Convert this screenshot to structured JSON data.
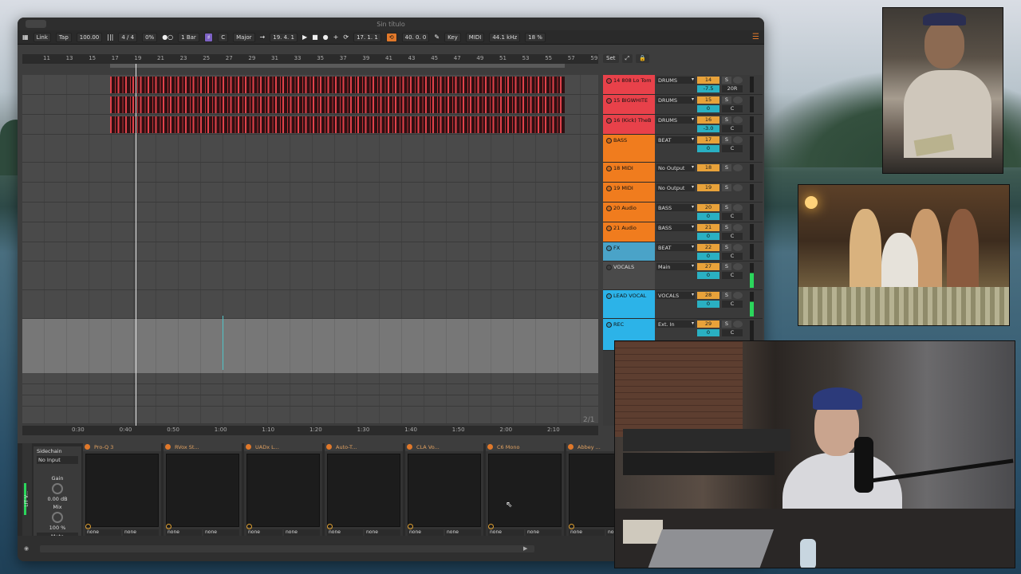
{
  "window": {
    "title": "Sin título"
  },
  "control_bar": {
    "link": "Link",
    "tap": "Tap",
    "tempo": "100.00",
    "signature": "4 / 4",
    "swing": "0%",
    "quantize": "1 Bar",
    "key": "C",
    "scale": "Major",
    "position": "19. 4. 1",
    "loop_start": "17. 1. 1",
    "loop_length": "40. 0. 0",
    "key_map": "Key",
    "midi_map": "MIDI",
    "sample_rate": "44.1 kHz",
    "cpu": "18 %"
  },
  "beat_ruler": [
    "11",
    "13",
    "15",
    "17",
    "19",
    "21",
    "23",
    "25",
    "27",
    "29",
    "31",
    "33",
    "35",
    "37",
    "39",
    "41",
    "43",
    "45",
    "47",
    "49",
    "51",
    "53",
    "55",
    "57",
    "59"
  ],
  "time_ruler": [
    "0:30",
    "0:40",
    "0:50",
    "1:00",
    "1:10",
    "1:20",
    "1:30",
    "1:40",
    "1:50",
    "2:00",
    "2:10"
  ],
  "set_buttons": {
    "set": "Set"
  },
  "page_indicator": "2/1",
  "tracks": [
    {
      "name": "14 808 Lo Tom",
      "route": "DRUMS",
      "num": "14",
      "vol": "-7.5",
      "pan": "20R",
      "color": "#e8414a"
    },
    {
      "name": "15 BIGWHITE",
      "route": "DRUMS",
      "num": "15",
      "vol": "0",
      "pan": "C",
      "color": "#e8414a"
    },
    {
      "name": "16 (Kick) TheB",
      "route": "DRUMS",
      "num": "16",
      "vol": "-3.0",
      "pan": "C",
      "color": "#e8414a"
    },
    {
      "name": "BASS",
      "route": "BEAT",
      "num": "17",
      "vol": "0",
      "pan": "C",
      "color": "#f07c1e"
    },
    {
      "name": "18 MIDI",
      "route": "No Output",
      "num": "18",
      "vol": "",
      "pan": "",
      "color": "#f07c1e"
    },
    {
      "name": "19 MIDI",
      "route": "No Output",
      "num": "19",
      "vol": "",
      "pan": "",
      "color": "#f07c1e"
    },
    {
      "name": "20 Audio",
      "route": "BASS",
      "num": "20",
      "vol": "0",
      "pan": "C",
      "color": "#f07c1e"
    },
    {
      "name": "21 Audio",
      "route": "BASS",
      "num": "21",
      "vol": "0",
      "pan": "C",
      "color": "#f07c1e"
    },
    {
      "name": "FX",
      "route": "BEAT",
      "num": "22",
      "vol": "0",
      "pan": "C",
      "color": "#4aa3c8"
    },
    {
      "name": "VOCALS",
      "route": "Main",
      "num": "27",
      "vol": "0",
      "pan": "C",
      "color": "#4a4a4a"
    },
    {
      "name": "LEAD VOCAL",
      "route": "VOCALS",
      "num": "28",
      "vol": "0",
      "pan": "C",
      "color": "#2cb3e8"
    },
    {
      "name": "REC",
      "route": "Ext. In",
      "num": "29",
      "vol": "0",
      "pan": "C",
      "color": "#2cb3e8"
    }
  ],
  "devices": {
    "rack_label": "LIT V...",
    "sidechain": {
      "title": "Sidechain",
      "input": "No Input",
      "gain_label": "Gain",
      "gain_value": "0.00 dB",
      "mix_label": "Mix",
      "mix_value": "100 %",
      "mute": "Mute"
    },
    "plugins": [
      {
        "name": "Pro-Q 3",
        "in": "none",
        "out": "none"
      },
      {
        "name": "RVox St...",
        "in": "none",
        "out": "none"
      },
      {
        "name": "UADx L...",
        "in": "none",
        "out": "none"
      },
      {
        "name": "Auto-T...",
        "in": "none",
        "out": "none"
      },
      {
        "name": "CLA Vo...",
        "in": "none",
        "out": "none"
      },
      {
        "name": "C6 Mono",
        "in": "none",
        "out": "none"
      },
      {
        "name": "Abbey ...",
        "in": "none",
        "out": "none"
      }
    ]
  }
}
